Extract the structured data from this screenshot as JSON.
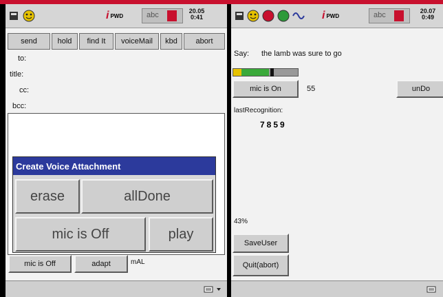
{
  "left": {
    "status": {
      "time_line1": "20.05",
      "time_line2": "0:41",
      "badge": "PWD",
      "sig": "abc"
    },
    "toolbar": {
      "send": "send",
      "hold": "hold",
      "find": "find It",
      "voicemail": "voiceMail",
      "kbd": "kbd",
      "abort": "abort"
    },
    "fields": {
      "to": "to:",
      "title": "title:",
      "cc": "cc:",
      "bcc": "bcc:"
    },
    "dialog": {
      "title": "Create Voice Attachment",
      "erase": "erase",
      "alldone": "allDone",
      "mic": "mic is Off",
      "play": "play"
    },
    "bottom": {
      "mic": "mic is Off",
      "adapt": "adapt",
      "mode": "mAL"
    }
  },
  "right": {
    "status": {
      "time_line1": "20.07",
      "time_line2": "0:49",
      "badge": "PWD",
      "sig": "abc"
    },
    "say_label": "Say:",
    "say_text": "the lamb was sure to go",
    "mic_button": "mic is On",
    "mic_value": "55",
    "undo": "unDo",
    "last_label": "lastRecognition:",
    "last_value": "7859",
    "progress_text": "43%",
    "progress_value": 0.43,
    "save_user": "SaveUser",
    "quit": "Quit(abort)"
  }
}
